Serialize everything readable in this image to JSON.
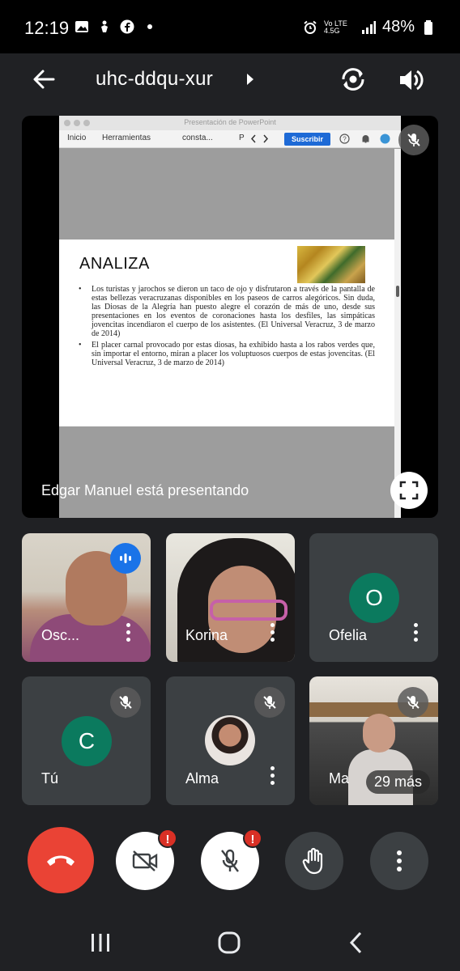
{
  "status_bar": {
    "time": "12:19",
    "network": "Vo LTE 4.5G",
    "battery": "48%"
  },
  "header": {
    "meeting_code": "uhc-ddqu-xur"
  },
  "presentation": {
    "window_title": "Presentación de PowerPoint",
    "ribbon_tabs": [
      "Inicio",
      "Herramientas",
      "consta...",
      "P"
    ],
    "subscribe_label": "Suscribir",
    "slide_title": "ANALIZA",
    "bullets": [
      "Los turistas y jarochos se dieron un taco de ojo y disfrutaron a través de la pantalla de estas bellezas veracruzanas disponibles en los paseos de carros alegóricos. Sin duda, las Diosas de la Alegría han puesto alegre el corazón de más de uno, desde sus presentaciones en los eventos de coronaciones hasta los desfiles, las simpáticas jovencitas incendiaron el cuerpo de los asistentes. (El Universal Veracruz, 3 de marzo de 2014)",
      "El placer carnal provocado por estas diosas, ha exhibido hasta a los rabos verdes que, sin importar el entorno, miran a placer los voluptuosos cuerpos de estas jovencitas. (El Universal Veracruz, 3 de marzo de 2014)"
    ],
    "presenting_label": "Edgar Manuel está presentando"
  },
  "participants": [
    {
      "name": "Osc...",
      "letter": "",
      "speaking": true
    },
    {
      "name": "Korina",
      "letter": ""
    },
    {
      "name": "Ofelia",
      "letter": "O"
    },
    {
      "name": "Tú",
      "letter": "C"
    },
    {
      "name": "Alma",
      "letter": ""
    },
    {
      "name": "Ma",
      "letter": ""
    }
  ],
  "more_participants": "29 más",
  "controls": {
    "end_call": "end-call",
    "camera_badge": "!",
    "mic_badge": "!"
  },
  "colors": {
    "end_call_red": "#ea4335",
    "avatar_green": "#0b7a5e",
    "speaking_blue": "#1a73e8"
  }
}
